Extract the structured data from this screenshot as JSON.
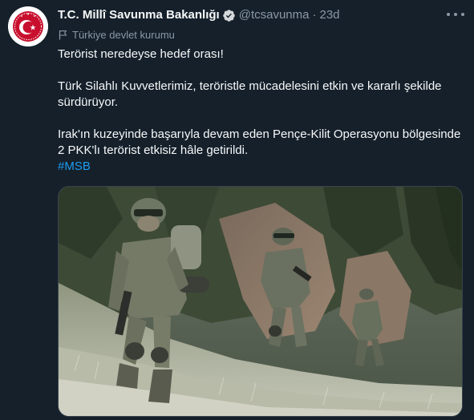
{
  "account": {
    "display_name": "T.C. Millî Savunma Bakanlığı",
    "handle": "@tcsavunma",
    "separator": "·",
    "time": "23d",
    "label": "Türkiye devlet kurumu",
    "verified_icon": "verified-badge-icon",
    "label_icon": "flag-icon"
  },
  "tweet": {
    "para1": "Terörist neredeyse hedef orası!",
    "para2_line1": "Türk Silahlı Kuvvetlerimiz, teröristle mücadelesini etkin ve kararlı şekilde",
    "para2_line2": "sürdürüyor.",
    "para3_line1": "Irak'ın kuzeyinde başarıyla devam eden Pençe-Kilit Operasyonu bölgesinde",
    "para3_line2": "2 PKK'lı terörist etkisiz hâle getirildi.",
    "hashtag": "#MSB"
  },
  "colors": {
    "background": "#15202b",
    "text": "#f7f9f9",
    "secondary": "#8b98a5",
    "link": "#1d9bf0",
    "verified": "#d6d9db",
    "seal_red": "#c8102e"
  }
}
